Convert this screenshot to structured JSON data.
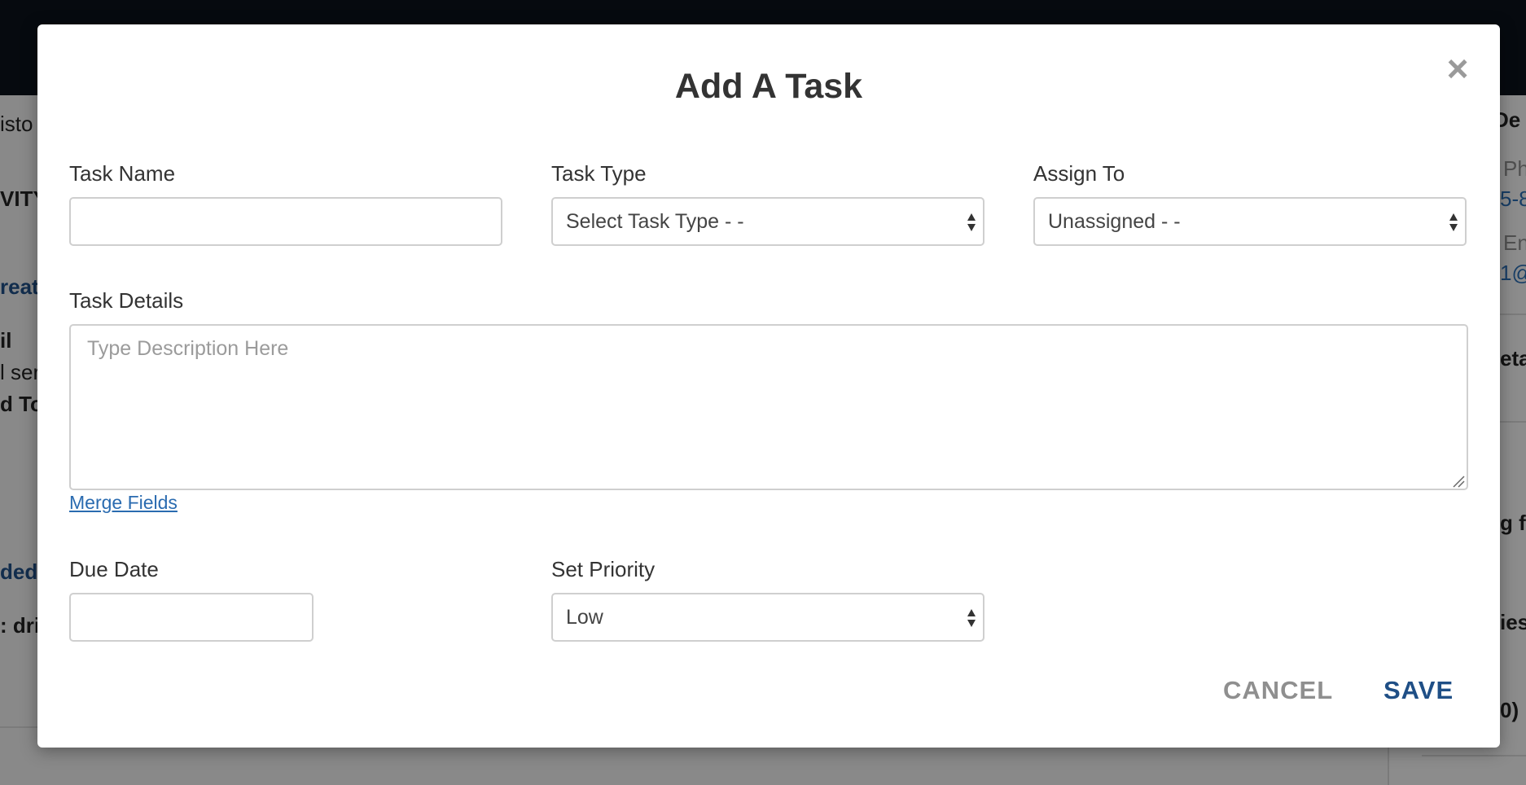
{
  "background": {
    "left_fragments": [
      "isto",
      "VITY",
      "reat",
      "il",
      "l ser",
      "d To",
      "ded",
      ": dri"
    ],
    "right_fragments": [
      "De",
      "Ph",
      "5-8",
      "En",
      "1@",
      "eta",
      "g f",
      "ies",
      "0)"
    ]
  },
  "modal": {
    "title": "Add A Task",
    "close_icon": "close-icon",
    "task_name": {
      "label": "Task Name",
      "value": ""
    },
    "task_type": {
      "label": "Task Type",
      "selected": "Select Task Type - -"
    },
    "assign_to": {
      "label": "Assign To",
      "selected": "Unassigned - -"
    },
    "task_details": {
      "label": "Task Details",
      "placeholder": "Type Description Here",
      "value": ""
    },
    "merge_fields_link": "Merge Fields",
    "due_date": {
      "label": "Due Date",
      "value": ""
    },
    "priority": {
      "label": "Set Priority",
      "selected": "Low"
    },
    "cancel_label": "CANCEL",
    "save_label": "SAVE"
  },
  "colors": {
    "primary": "#1f4f86",
    "link": "#2a6bb0",
    "muted_button": "#8f8f8f",
    "topbar": "#0c121a"
  }
}
